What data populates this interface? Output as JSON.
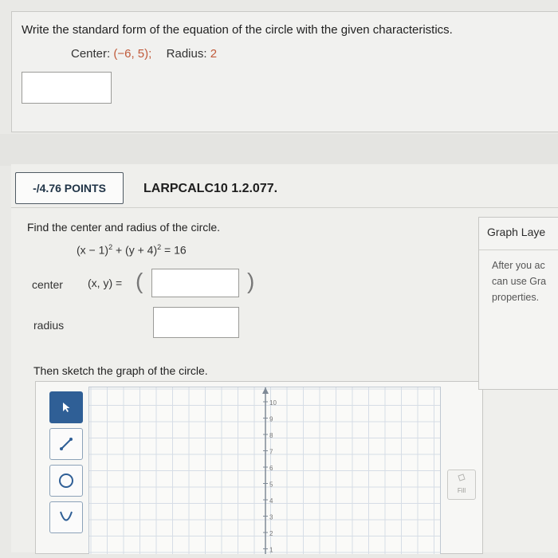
{
  "question1": {
    "prompt": "Write the standard form of the equation of the circle with the given characteristics.",
    "center_label": "Center:",
    "center_value": "(−6, 5);",
    "radius_label": "Radius:",
    "radius_value": "2"
  },
  "question2": {
    "points": "-/4.76 POINTS",
    "problem_id": "LARPCALC10 1.2.077.",
    "prompt": "Find the center and radius of the circle.",
    "equation": {
      "part1": "(x − 1)",
      "exp1": "2",
      "part2": " + (y + 4)",
      "exp2": "2",
      "part3": " = 16"
    },
    "center_label": "center",
    "center_expr": "(x, y) =",
    "radius_label": "radius",
    "sketch_prompt": "Then sketch the graph of the circle."
  },
  "graph": {
    "y_ticks": [
      "10",
      "9",
      "8",
      "7",
      "6",
      "5",
      "4",
      "3",
      "2",
      "1"
    ],
    "fill_label": "Fill",
    "tools": [
      "pointer-icon",
      "line-tool-icon",
      "circle-tool-icon",
      "parabola-tool-icon"
    ]
  },
  "layers_panel": {
    "title": "Graph Laye",
    "text_line1": "After you ac",
    "text_line2": "can use Gra",
    "text_line3": "properties."
  },
  "colors": {
    "accent": "#2f5f96",
    "highlight": "#c05a3a"
  }
}
